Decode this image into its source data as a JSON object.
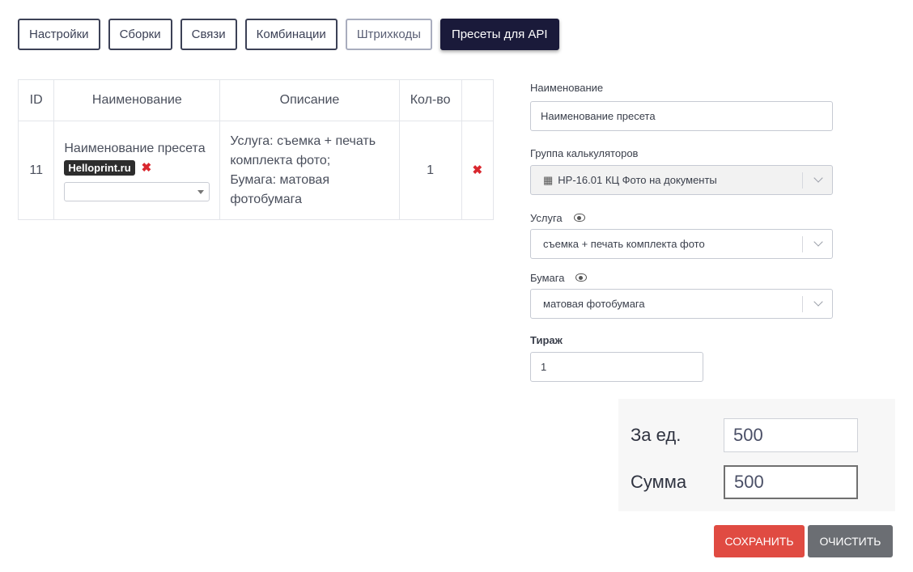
{
  "tabs": [
    {
      "label": "Настройки"
    },
    {
      "label": "Сборки"
    },
    {
      "label": "Связи"
    },
    {
      "label": "Комбинации"
    },
    {
      "label": "Штрихкоды"
    },
    {
      "label": "Пресеты для API"
    }
  ],
  "table": {
    "headers": {
      "id": "ID",
      "name": "Наименование",
      "description": "Описание",
      "qty": "Кол-во"
    },
    "rows": [
      {
        "id": "11",
        "name": "Наименование пресета",
        "tag": "Helloprint.ru",
        "description_lines": [
          "Услуга: съемка + печать комплекта фото;",
          "Бумага: матовая фотобумага"
        ],
        "qty": "1"
      }
    ]
  },
  "form": {
    "name_label": "Наименование",
    "name_value": "Наименование пресета",
    "group_label": "Группа калькуляторов",
    "group_value": "HP-16.01 КЦ Фото на документы",
    "service_label": "Услуга",
    "service_value": "съемка + печать комплекта фото",
    "paper_label": "Бумага",
    "paper_value": "матовая фотобумага",
    "run_label": "Тираж",
    "run_value": "1"
  },
  "totals": {
    "unit_label": "За ед.",
    "unit_value": "500",
    "sum_label": "Сумма",
    "sum_value": "500"
  },
  "actions": {
    "save_label": "Сохранить",
    "clear_label": "Очистить"
  },
  "colors": {
    "active_tab": "#1a1a3a",
    "delete_icon": "#d9272e",
    "save_button": "#e04b42",
    "clear_button": "#6b6e73"
  }
}
